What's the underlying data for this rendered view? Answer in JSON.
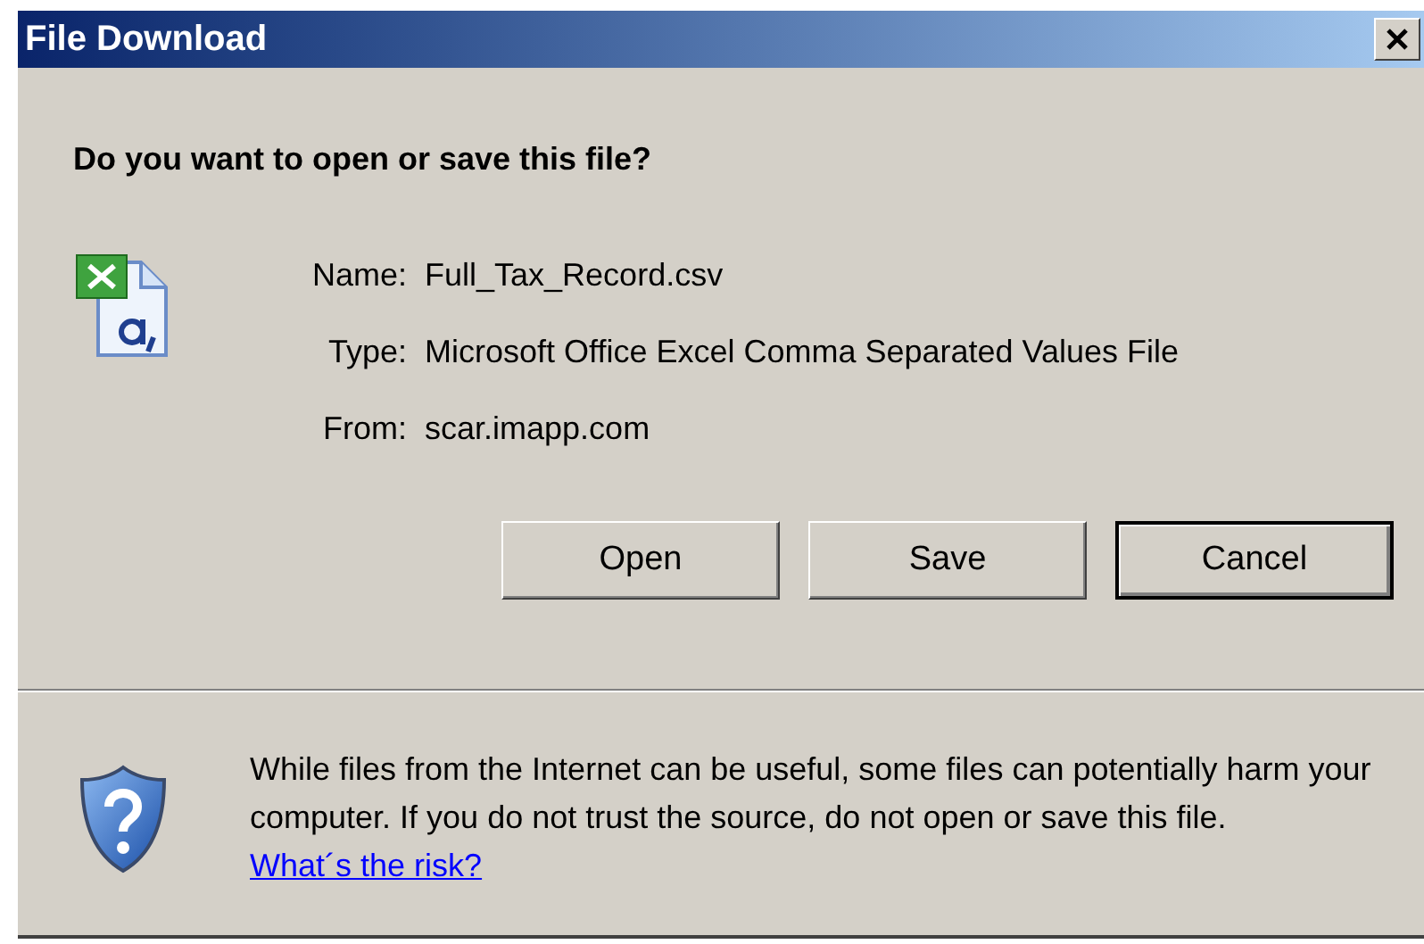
{
  "window": {
    "title": "File Download"
  },
  "question": "Do you want to open or save this file?",
  "details": [
    {
      "label": "Name:",
      "value": "Full_Tax_Record.csv"
    },
    {
      "label": "Type:",
      "value": "Microsoft Office Excel Comma Separated Values File"
    },
    {
      "label": "From:",
      "value": "scar.imapp.com"
    }
  ],
  "buttons": [
    {
      "label": "Open",
      "default": false
    },
    {
      "label": "Save",
      "default": false
    },
    {
      "label": "Cancel",
      "default": true
    }
  ],
  "warning": {
    "text": "While files from the Internet can be useful, some files can potentially harm your computer. If you do not trust the source, do not open or save this file.",
    "link": "What´s the risk?"
  }
}
